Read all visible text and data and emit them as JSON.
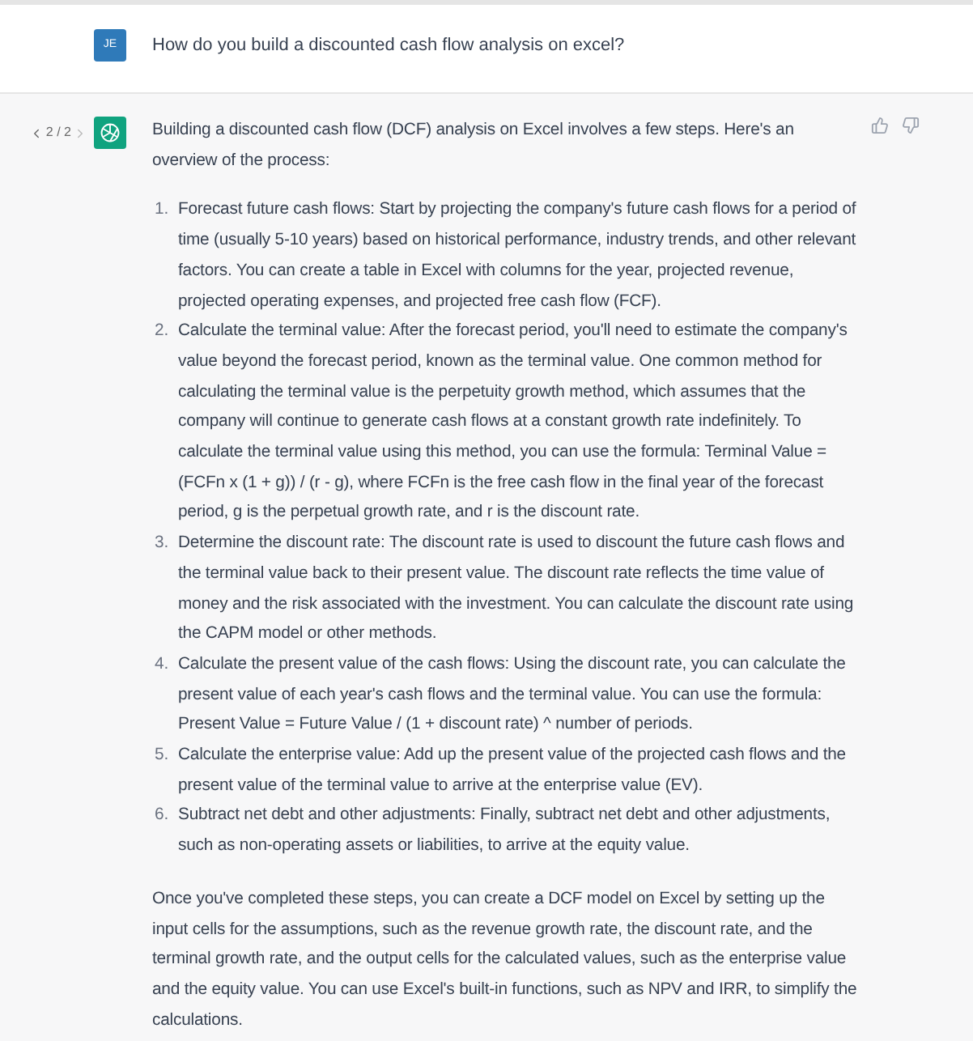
{
  "user_message": {
    "avatar": "JE",
    "text": "How do you build a discounted cash flow analysis on excel?"
  },
  "response": {
    "pager": "2 / 2",
    "intro": "Building a discounted cash flow (DCF) analysis on Excel involves a few steps. Here's an overview of the process:",
    "steps": [
      {
        "number": "1.",
        "text": "Forecast future cash flows: Start by projecting the company's future cash flows for a period of time (usually 5-10 years) based on historical performance, industry trends, and other relevant factors. You can create a table in Excel with columns for the year, projected revenue, projected operating expenses, and projected free cash flow (FCF)."
      },
      {
        "number": "2.",
        "text": "Calculate the terminal value: After the forecast period, you'll need to estimate the company's value beyond the forecast period, known as the terminal value. One common method for calculating the terminal value is the perpetuity growth method, which assumes that the company will continue to generate cash flows at a constant growth rate indefinitely. To calculate the terminal value using this method, you can use the formula: Terminal Value = (FCFn x (1 + g)) / (r - g), where FCFn is the free cash flow in the final year of the forecast period, g is the perpetual growth rate, and r is the discount rate."
      },
      {
        "number": "3.",
        "text": "Determine the discount rate: The discount rate is used to discount the future cash flows and the terminal value back to their present value. The discount rate reflects the time value of money and the risk associated with the investment. You can calculate the discount rate using the CAPM model or other methods."
      },
      {
        "number": "4.",
        "text": "Calculate the present value of the cash flows: Using the discount rate, you can calculate the present value of each year's cash flows and the terminal value. You can use the formula: Present Value = Future Value / (1 + discount rate) ^ number of periods."
      },
      {
        "number": "5.",
        "text": "Calculate the enterprise value: Add up the present value of the projected cash flows and the present value of the terminal value to arrive at the enterprise value (EV)."
      },
      {
        "number": "6.",
        "text": "Subtract net debt and other adjustments: Finally, subtract net debt and other adjustments, such as non-operating assets or liabilities, to arrive at the equity value."
      }
    ],
    "closing": "Once you've completed these steps, you can create a DCF model on Excel by setting up the input cells for the assumptions, such as the revenue growth rate, the discount rate, and the terminal growth rate, and the output cells for the calculated values, such as the enterprise value and the equity value. You can use Excel's built-in functions, such as NPV and IRR, to simplify the calculations."
  }
}
